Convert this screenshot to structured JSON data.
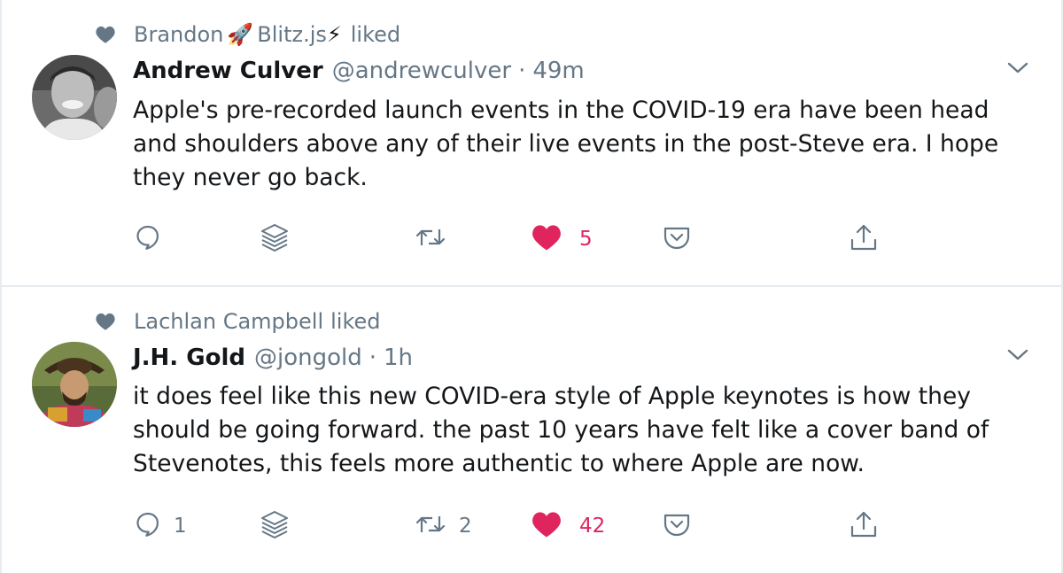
{
  "tweets": [
    {
      "social_context": {
        "icon": "heart-icon",
        "names_before_emoji": "Brandon",
        "emoji_1": "🚀",
        "names_middle": "Blitz.js",
        "emoji_2": "⚡",
        "action": "liked"
      },
      "author": {
        "name": "Andrew Culver",
        "handle": "@andrewculver",
        "separator": "·",
        "time": "49m"
      },
      "text": "Apple's pre-recorded launch events in the COVID-19 era have been head and shoulders above any of their live events in the post-Steve era. I hope they never go back.",
      "actions": {
        "reply_count": "",
        "retweet_count": "",
        "like_count": "5",
        "liked": true
      }
    },
    {
      "social_context": {
        "icon": "heart-icon",
        "names": "Lachlan Campbell",
        "action": "liked"
      },
      "author": {
        "name": "J.H. Gold",
        "handle": "@jongold",
        "separator": "·",
        "time": "1h"
      },
      "text": "it does feel like this new COVID-era style of Apple keynotes is how they should be going forward. the past 10 years have felt like a cover band of Stevenotes, this feels more authentic to where Apple are now.",
      "actions": {
        "reply_count": "1",
        "retweet_count": "2",
        "like_count": "42",
        "liked": true
      }
    }
  ],
  "colors": {
    "text_primary": "#14171a",
    "text_secondary": "#657786",
    "like_active": "#e0245e",
    "divider": "#e6ecf0"
  }
}
